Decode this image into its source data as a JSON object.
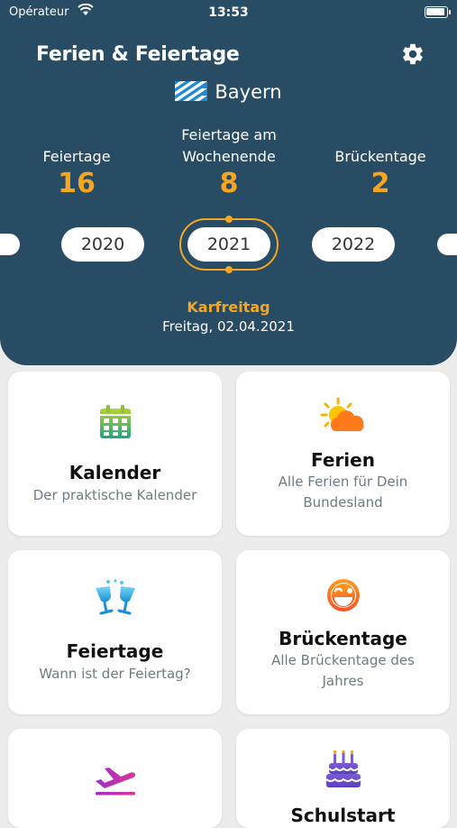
{
  "status": {
    "carrier": "Opérateur",
    "time": "13:53"
  },
  "header": {
    "title": "Ferien & Feiertage",
    "region": "Bayern",
    "stats": [
      {
        "label": "Feiertage",
        "value": "16"
      },
      {
        "label": "Feiertage am Wochenende",
        "value": "8"
      },
      {
        "label": "Brückentage",
        "value": "2"
      }
    ],
    "years": {
      "prev": "2020",
      "selected": "2021",
      "next": "2022"
    },
    "next_holiday": {
      "name": "Karfreitag",
      "date": "Freitag, 02.04.2021"
    }
  },
  "cards": [
    {
      "title": "Kalender",
      "subtitle": "Der praktische Kalender",
      "icon": "calendar-icon"
    },
    {
      "title": "Ferien",
      "subtitle": "Alle Ferien für Dein Bundesland",
      "icon": "sun-cloud-icon"
    },
    {
      "title": "Feiertage",
      "subtitle": "Wann ist der Feiertag?",
      "icon": "champagne-glasses-icon"
    },
    {
      "title": "Brückentage",
      "subtitle": "Alle Brückentage des Jahres",
      "icon": "winking-face-icon"
    },
    {
      "title": "",
      "subtitle": "",
      "icon": "airplane-departure-icon"
    },
    {
      "title": "Schulstart",
      "subtitle": "",
      "icon": "birthday-cake-icon"
    }
  ],
  "colors": {
    "header_bg": "#274c63",
    "accent": "#f5a623",
    "background": "#ececec"
  }
}
